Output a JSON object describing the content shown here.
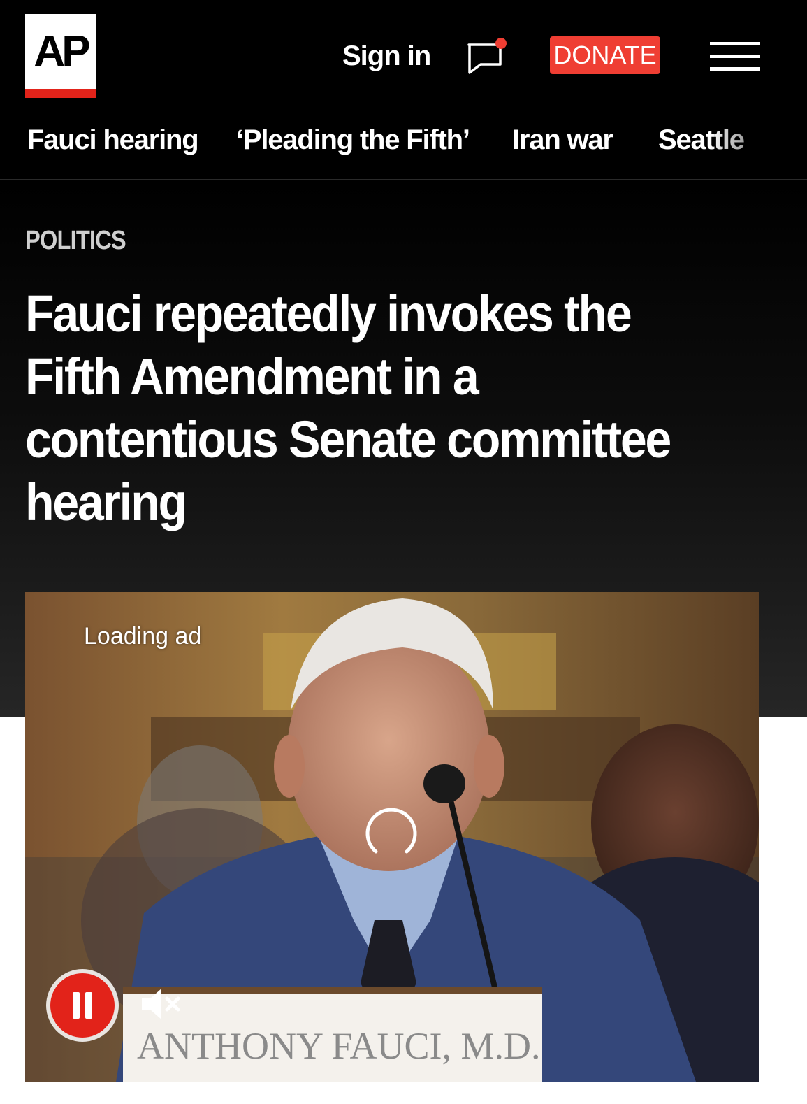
{
  "header": {
    "logo_text": "AP",
    "sign_in": "Sign in",
    "donate": "DONATE"
  },
  "nav": {
    "items": [
      "Fauci hearing",
      "‘Pleading the Fifth’",
      "Iran war",
      "Seattle"
    ]
  },
  "article": {
    "section": "POLITICS",
    "headline": "Fauci repeatedly invokes the Fifth Amendment in a contentious Senate committee hearing"
  },
  "video": {
    "status": "Loading ad",
    "nameplate": "ANTHONY FAUCI, M.D."
  },
  "colors": {
    "brand_red": "#e2231a",
    "donate_red": "#ef3e33",
    "background": "#000000"
  },
  "icons": [
    "chat-notification-icon",
    "hamburger-menu-icon",
    "loading-spinner-icon",
    "pause-icon",
    "muted-speaker-icon"
  ]
}
